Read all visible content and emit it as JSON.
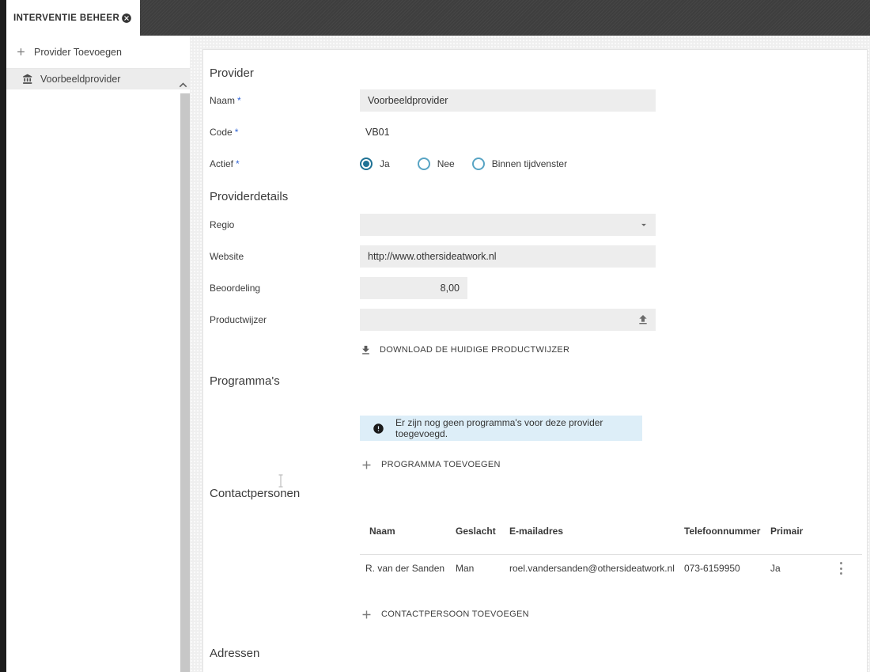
{
  "tab": {
    "title": "INTERVENTIE BEHEER"
  },
  "sidebar": {
    "items": [
      {
        "label": "Provider Toevoegen",
        "icon": "plus-icon"
      },
      {
        "label": "Voorbeeldprovider",
        "icon": "bank-icon"
      }
    ]
  },
  "provider_section": {
    "title": "Provider",
    "naam_label": "Naam",
    "naam_value": "Voorbeeldprovider",
    "code_label": "Code",
    "code_value": "VB01",
    "actief_label": "Actief",
    "actief_options": [
      "Ja",
      "Nee",
      "Binnen tijdvenster"
    ],
    "actief_selected": "Ja"
  },
  "details_section": {
    "title": "Providerdetails",
    "regio_label": "Regio",
    "website_label": "Website",
    "website_value": "http://www.othersideatwork.nl",
    "beoordeling_label": "Beoordeling",
    "beoordeling_value": "8,00",
    "productwijzer_label": "Productwijzer",
    "download_label": "DOWNLOAD DE HUIDIGE PRODUCTWIJZER"
  },
  "programmas_section": {
    "title": "Programma's",
    "empty_message": "Er zijn nog geen programma's voor deze provider toegevoegd.",
    "add_label": "PROGRAMMA TOEVOEGEN"
  },
  "contacts_section": {
    "title": "Contactpersonen",
    "columns": [
      "Naam",
      "Geslacht",
      "E-mailadres",
      "Telefoonnummer",
      "Primair"
    ],
    "rows": [
      [
        "R. van der Sanden",
        "Man",
        "roel.vandersanden@othersideatwork.nl",
        "073-6159950",
        "Ja"
      ]
    ],
    "add_label": "CONTACTPERSOON TOEVOEGEN"
  },
  "adressen_section": {
    "title": "Adressen"
  },
  "colors": {
    "topbar": "#3e3e3e",
    "radio_teal": "#1f7295",
    "required_asterisk": "#3366d6",
    "info_bg": "#ddeef8",
    "field_bg": "#ededed"
  }
}
